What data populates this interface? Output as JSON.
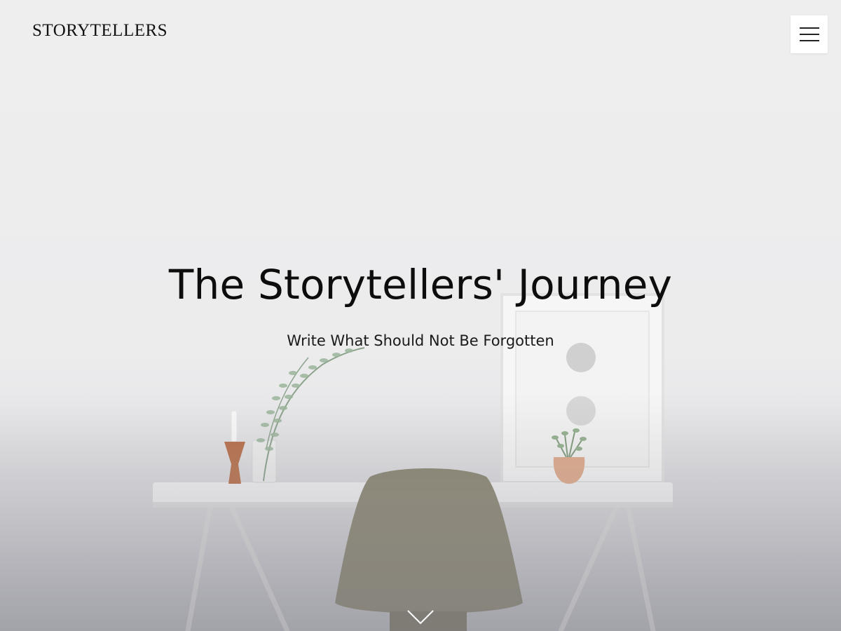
{
  "header": {
    "logo_text": "STORYTELLERS",
    "menu_icon": "hamburger-menu-icon"
  },
  "hero": {
    "title": "The Storytellers' Journey",
    "subtitle": "Write What Should Not Be Forgotten",
    "scroll_icon": "chevron-down-icon"
  },
  "colors": {
    "text": "#111111",
    "background": "#eeeeef",
    "menu_button_bg": "#ffffff"
  }
}
